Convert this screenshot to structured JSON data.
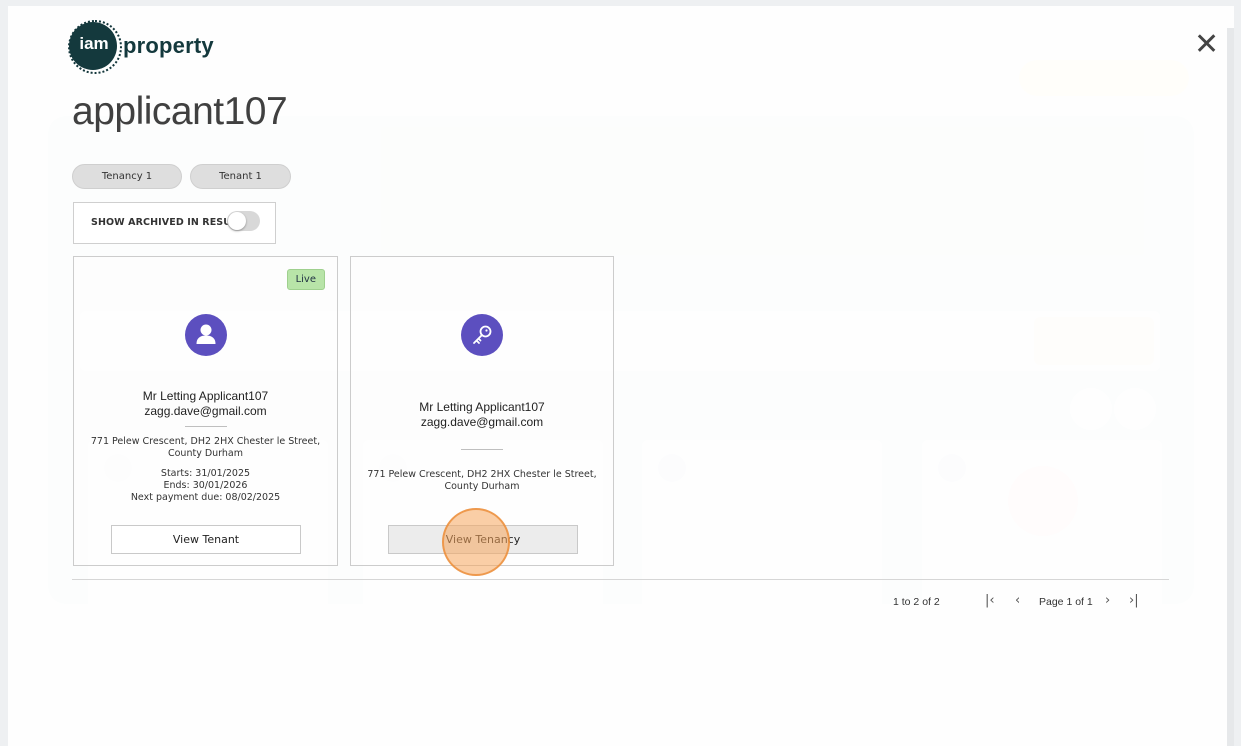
{
  "modal": {
    "logo_iam": "iam",
    "logo_property": "property",
    "title": "applicant107",
    "close": "✕"
  },
  "chips": [
    {
      "label": "Tenancy 1"
    },
    {
      "label": "Tenant 1"
    }
  ],
  "archive_filter": {
    "label": "SHOW ARCHIVED IN RESULTS",
    "enabled": false
  },
  "cards": [
    {
      "type": "tenant",
      "badge": "Live",
      "icon": "person-icon",
      "name": "Mr Letting Applicant107",
      "email": "zagg.dave@gmail.com",
      "address_line1": "771 Pelew Crescent, DH2 2HX Chester le Street,",
      "address_line2": "County Durham",
      "starts": "Starts: 31/01/2025",
      "ends": "Ends: 30/01/2026",
      "next_payment": "Next payment due: 08/02/2025",
      "button": "View Tenant"
    },
    {
      "type": "tenancy",
      "icon": "key-icon",
      "name": "Mr Letting Applicant107",
      "email": "zagg.dave@gmail.com",
      "address_line1": "771 Pelew Crescent, DH2 2HX Chester le Street,",
      "address_line2": "County Durham",
      "button": "View Tenancy"
    }
  ],
  "pagination": {
    "range": "1 to 2 of 2",
    "page": "Page 1 of 1",
    "first": "|‹",
    "prev": "‹",
    "next": "›",
    "last": "›|"
  },
  "colors": {
    "avatar": "#5c4fbf",
    "badge_live": "#b8e4a8",
    "logo_dark": "#14393d",
    "click_indicator": "#f5a65c"
  }
}
